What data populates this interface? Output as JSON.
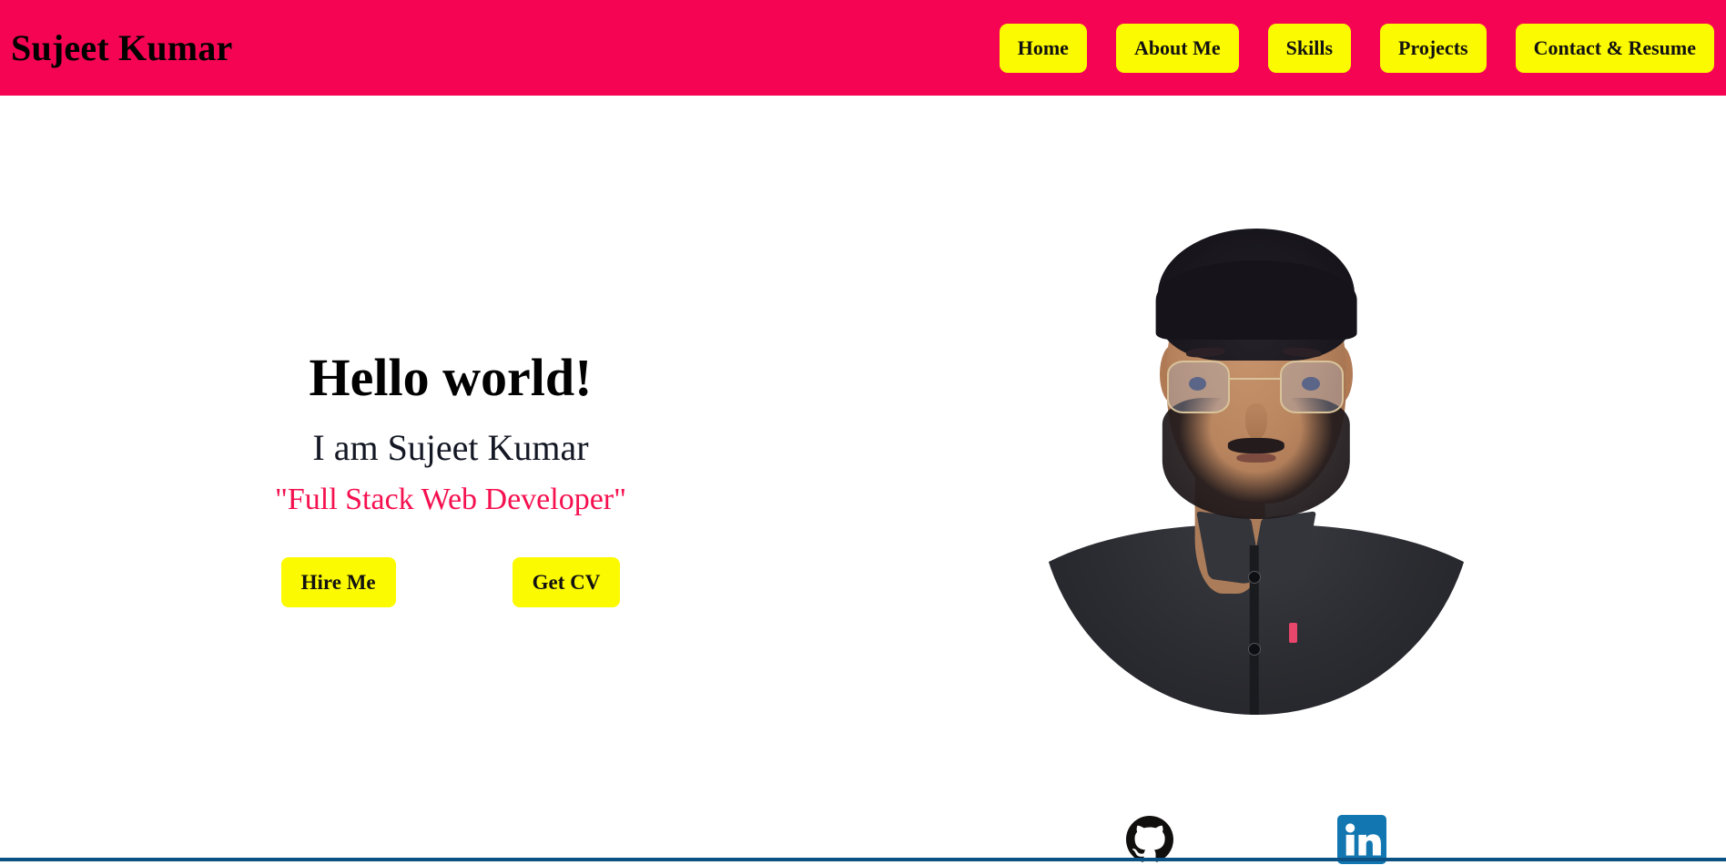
{
  "header": {
    "brand": "Sujeet Kumar",
    "brand_color": "#000000",
    "background_color": "#f50454",
    "nav": [
      {
        "label": "Home",
        "name": "nav-home"
      },
      {
        "label": "About Me",
        "name": "nav-about-me"
      },
      {
        "label": "Skills",
        "name": "nav-skills"
      },
      {
        "label": "Projects",
        "name": "nav-projects"
      },
      {
        "label": "Contact & Resume",
        "name": "nav-contact-resume"
      }
    ],
    "nav_button_color": "#fcfa00"
  },
  "hero": {
    "title": "Hello world!",
    "subtitle": "I am Sujeet Kumar",
    "tagline": "\"Full Stack Web Developer\"",
    "tagline_color": "#f5104f",
    "buttons": [
      {
        "label": "Hire Me",
        "name": "hire-me-button"
      },
      {
        "label": "Get CV",
        "name": "get-cv-button"
      }
    ],
    "button_color": "#fcfa00",
    "portrait_alt": "Portrait photo of Sujeet Kumar"
  },
  "socials": [
    {
      "label": "GitHub",
      "icon": "github-icon",
      "color": "#100f0d"
    },
    {
      "label": "LinkedIn",
      "icon": "linkedin-icon",
      "color": "#1277b0"
    }
  ],
  "divider": {
    "color": "#0b5184"
  }
}
